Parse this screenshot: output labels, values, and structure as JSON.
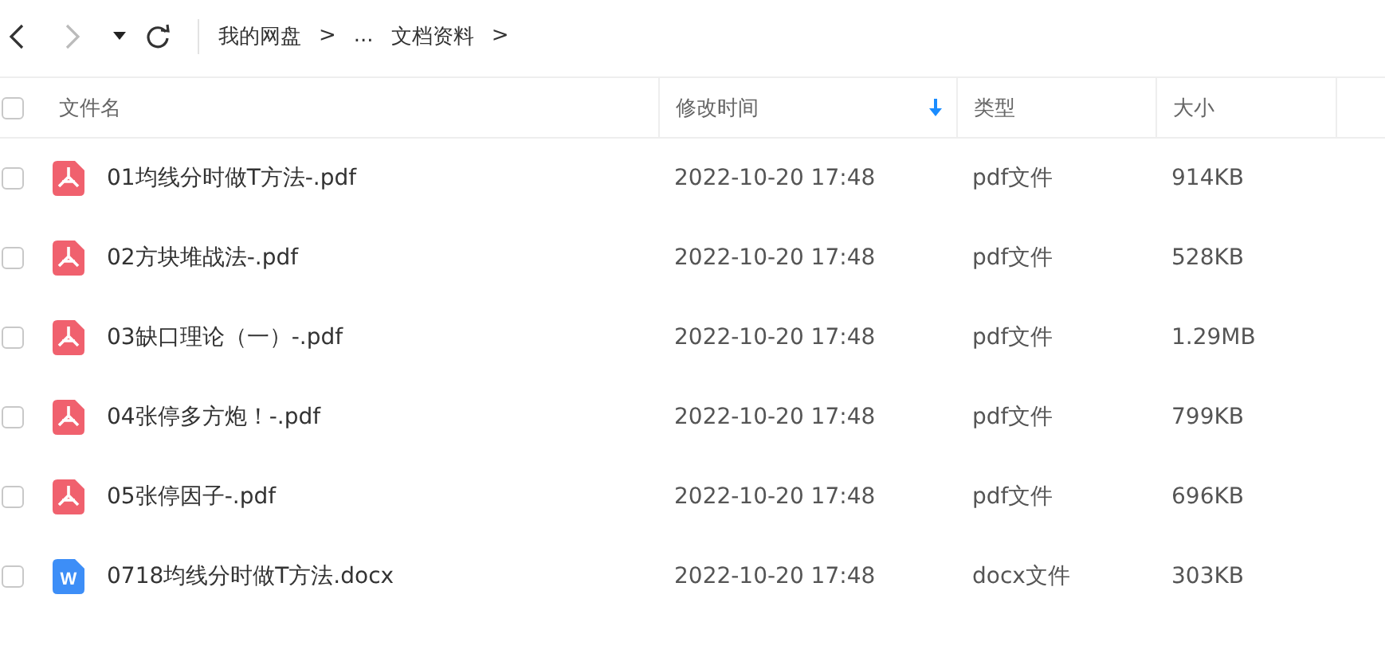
{
  "toolbar": {
    "breadcrumbs": [
      {
        "label": "我的网盘"
      },
      {
        "label": "..."
      },
      {
        "label": "文档资料"
      }
    ],
    "separator": ">"
  },
  "table": {
    "select_all": {
      "checked": false
    },
    "columns": [
      {
        "label": "文件名",
        "sorted": false
      },
      {
        "label": "修改时间",
        "sorted": true
      },
      {
        "label": "类型",
        "sorted": false
      },
      {
        "label": "大小",
        "sorted": false
      }
    ],
    "rows": [
      {
        "checked": false,
        "kind": "pdf",
        "name": "01均线分时做T方法-.pdf",
        "modified": "2022-10-20 17:48",
        "type": "pdf文件",
        "size": "914KB"
      },
      {
        "checked": false,
        "kind": "pdf",
        "name": "02方块堆战法-.pdf",
        "modified": "2022-10-20 17:48",
        "type": "pdf文件",
        "size": "528KB"
      },
      {
        "checked": false,
        "kind": "pdf",
        "name": "03缺口理论（一）-.pdf",
        "modified": "2022-10-20 17:48",
        "type": "pdf文件",
        "size": "1.29MB"
      },
      {
        "checked": false,
        "kind": "pdf",
        "name": "04张停多方炮！-.pdf",
        "modified": "2022-10-20 17:48",
        "type": "pdf文件",
        "size": "799KB"
      },
      {
        "checked": false,
        "kind": "pdf",
        "name": "05张停因子-.pdf",
        "modified": "2022-10-20 17:48",
        "type": "pdf文件",
        "size": "696KB"
      },
      {
        "checked": false,
        "kind": "doc",
        "icon_text": "W",
        "name": "0718均线分时做T方法.docx",
        "modified": "2022-10-20 17:48",
        "type": "docx文件",
        "size": "303KB"
      }
    ]
  }
}
